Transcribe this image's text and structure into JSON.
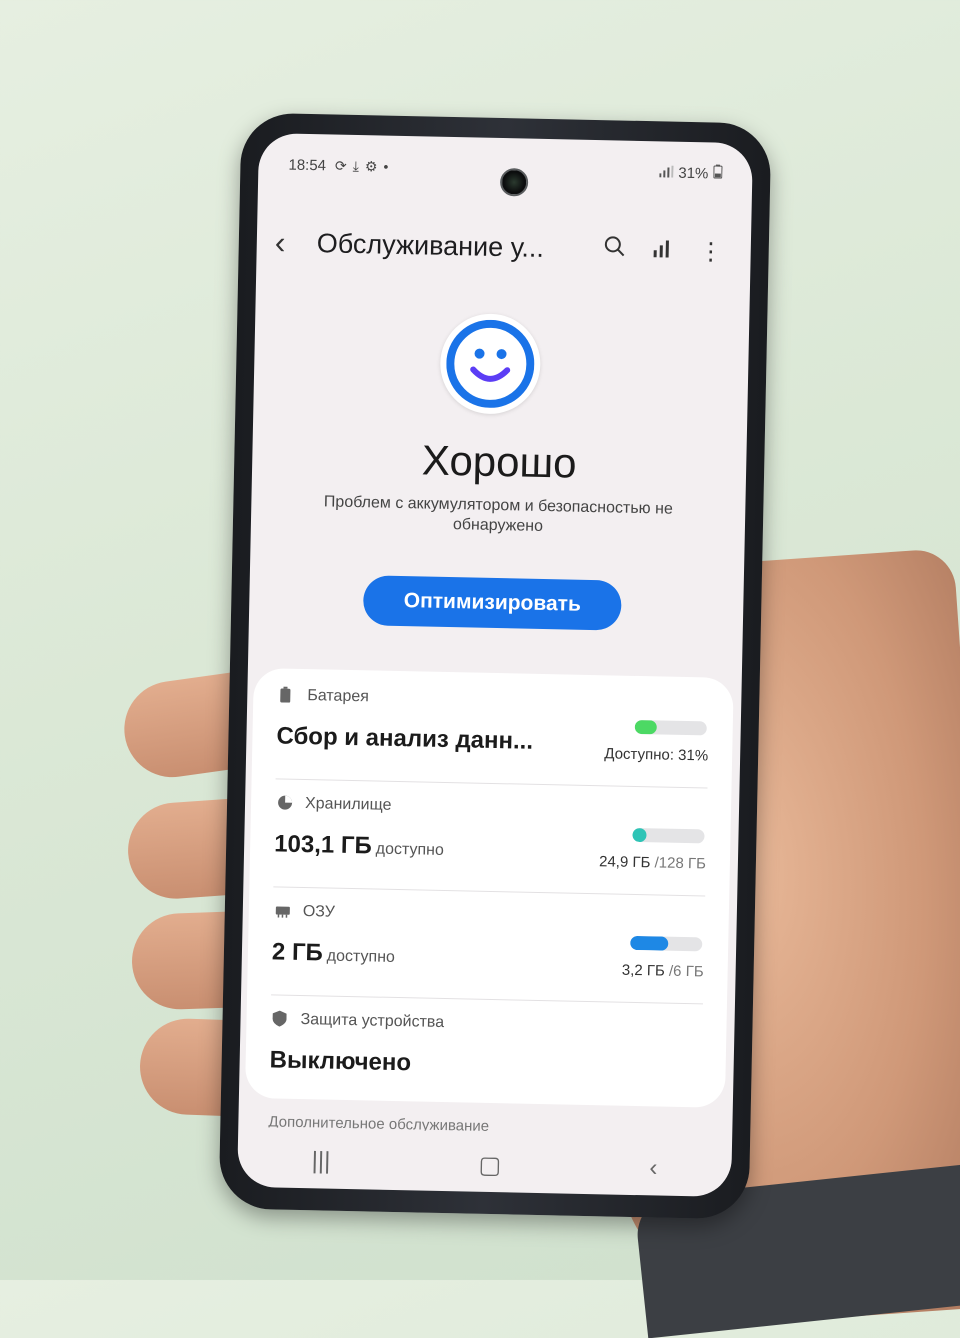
{
  "statusbar": {
    "time": "18:54",
    "battery": "31%",
    "icons": [
      "sync-icon",
      "download-icon",
      "settings-icon",
      "dot-icon",
      "signal-icon",
      "battery-icon"
    ]
  },
  "appbar": {
    "title": "Обслуживание у..."
  },
  "status": {
    "title": "Хорошо",
    "description": "Проблем с аккумулятором и безопасностью не обнаружено"
  },
  "optimize_button": "Оптимизировать",
  "sections": {
    "battery": {
      "label": "Батарея",
      "value": "Сбор и анализ данн...",
      "meta": "Доступно: 31%",
      "level": 0.31,
      "color": "#4cd964"
    },
    "storage": {
      "label": "Хранилище",
      "value": "103,1 ГБ",
      "suffix": "доступно",
      "used": "24,9 ГБ",
      "total": "/128 ГБ",
      "level": 0.19,
      "color": "#2ec4b6"
    },
    "ram": {
      "label": "ОЗУ",
      "value": "2 ГБ",
      "suffix": "доступно",
      "used": "3,2 ГБ",
      "total": "/6 ГБ",
      "level": 0.53,
      "color": "#1e88e5"
    },
    "security": {
      "label": "Защита устройства",
      "value": "Выключено"
    }
  },
  "more_label": "Дополнительное обслуживание",
  "colors": {
    "accent": "#1a73e8",
    "smile": "#3d5afe"
  }
}
